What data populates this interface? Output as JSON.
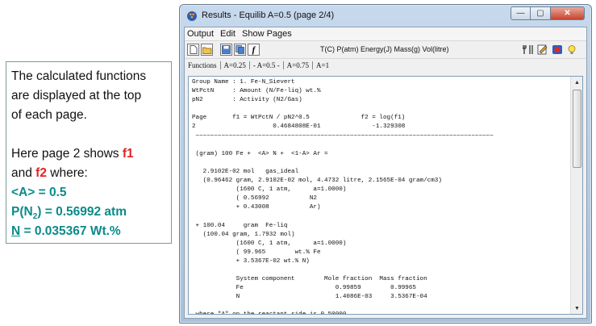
{
  "note": {
    "line1": "The calculated functions",
    "line2": "are displayed at the top",
    "line3": "of each page.",
    "line4_pre": "Here page 2 shows ",
    "line4_f1": "f1",
    "line5_pre": "and ",
    "line5_f2": "f2",
    "line5_post": "  where:",
    "line6": "<A> = 0.5",
    "line7_a": "P(N",
    "line7_sub": "2",
    "line7_b": ") = 0.56992 atm",
    "line8_n": "N",
    "line8_rest": " = 0.035367 Wt.%"
  },
  "window": {
    "title": "Results - Equilib  A=0.5  (page 2/4)",
    "buttons": {
      "minimize": "—",
      "maximize": "▢",
      "close": "✕"
    }
  },
  "menu": [
    "Output",
    "Edit",
    "Show Pages"
  ],
  "toolbar": {
    "units": "T(C)  P(atm)  Energy(J)  Mass(g)  Vol(litre)"
  },
  "functions_bar": [
    "Functions",
    "A=0.25",
    "- A=0.5 -",
    "A=0.75",
    "A=1"
  ],
  "content_lines": [
    "Group Name : 1. Fe-N_Sievert",
    "WtPctN     : Amount (N/Fe-liq) wt.%",
    "pN2        : Activity (N2/Gas)",
    "",
    "Page       f1 = WtPctN / pN2^0.5              f2 = log(f1)",
    "2                     0.4684808E-01              -1.329308",
    " ~~~~~~~~~~~~~~~~~~~~~~~~~~~~~~~~~~~~~~~~~~~~~~~~~~~~~~~~~~~~~~~~~~~~~~~~~~~~~~~~~",
    "",
    " (gram) 100 Fe +  <A> N +  <1-A> Ar =",
    "",
    "   2.9102E-02 mol   gas_ideal",
    "   (0.96462 gram, 2.9102E-02 mol, 4.4732 litre, 2.1565E-04 gram/cm3)",
    "            (1600 C, 1 atm,      a=1.0000)",
    "            ( 0.56992           N2",
    "            + 0.43008           Ar)",
    "",
    " + 100.04     gram  Fe-liq",
    "   (100.04 gram, 1.7932 mol)",
    "            (1600 C, 1 atm,      a=1.0000)",
    "            ( 99.965        wt.% Fe",
    "            + 3.5367E-02 wt.% N)",
    "",
    "            System component        Mole fraction  Mass fraction",
    "            Fe                         0.99859        0.99965",
    "            N                          1.4086E-03     3.5367E-04",
    "",
    " where \"A\" on the reactant side is 0.50000"
  ]
}
